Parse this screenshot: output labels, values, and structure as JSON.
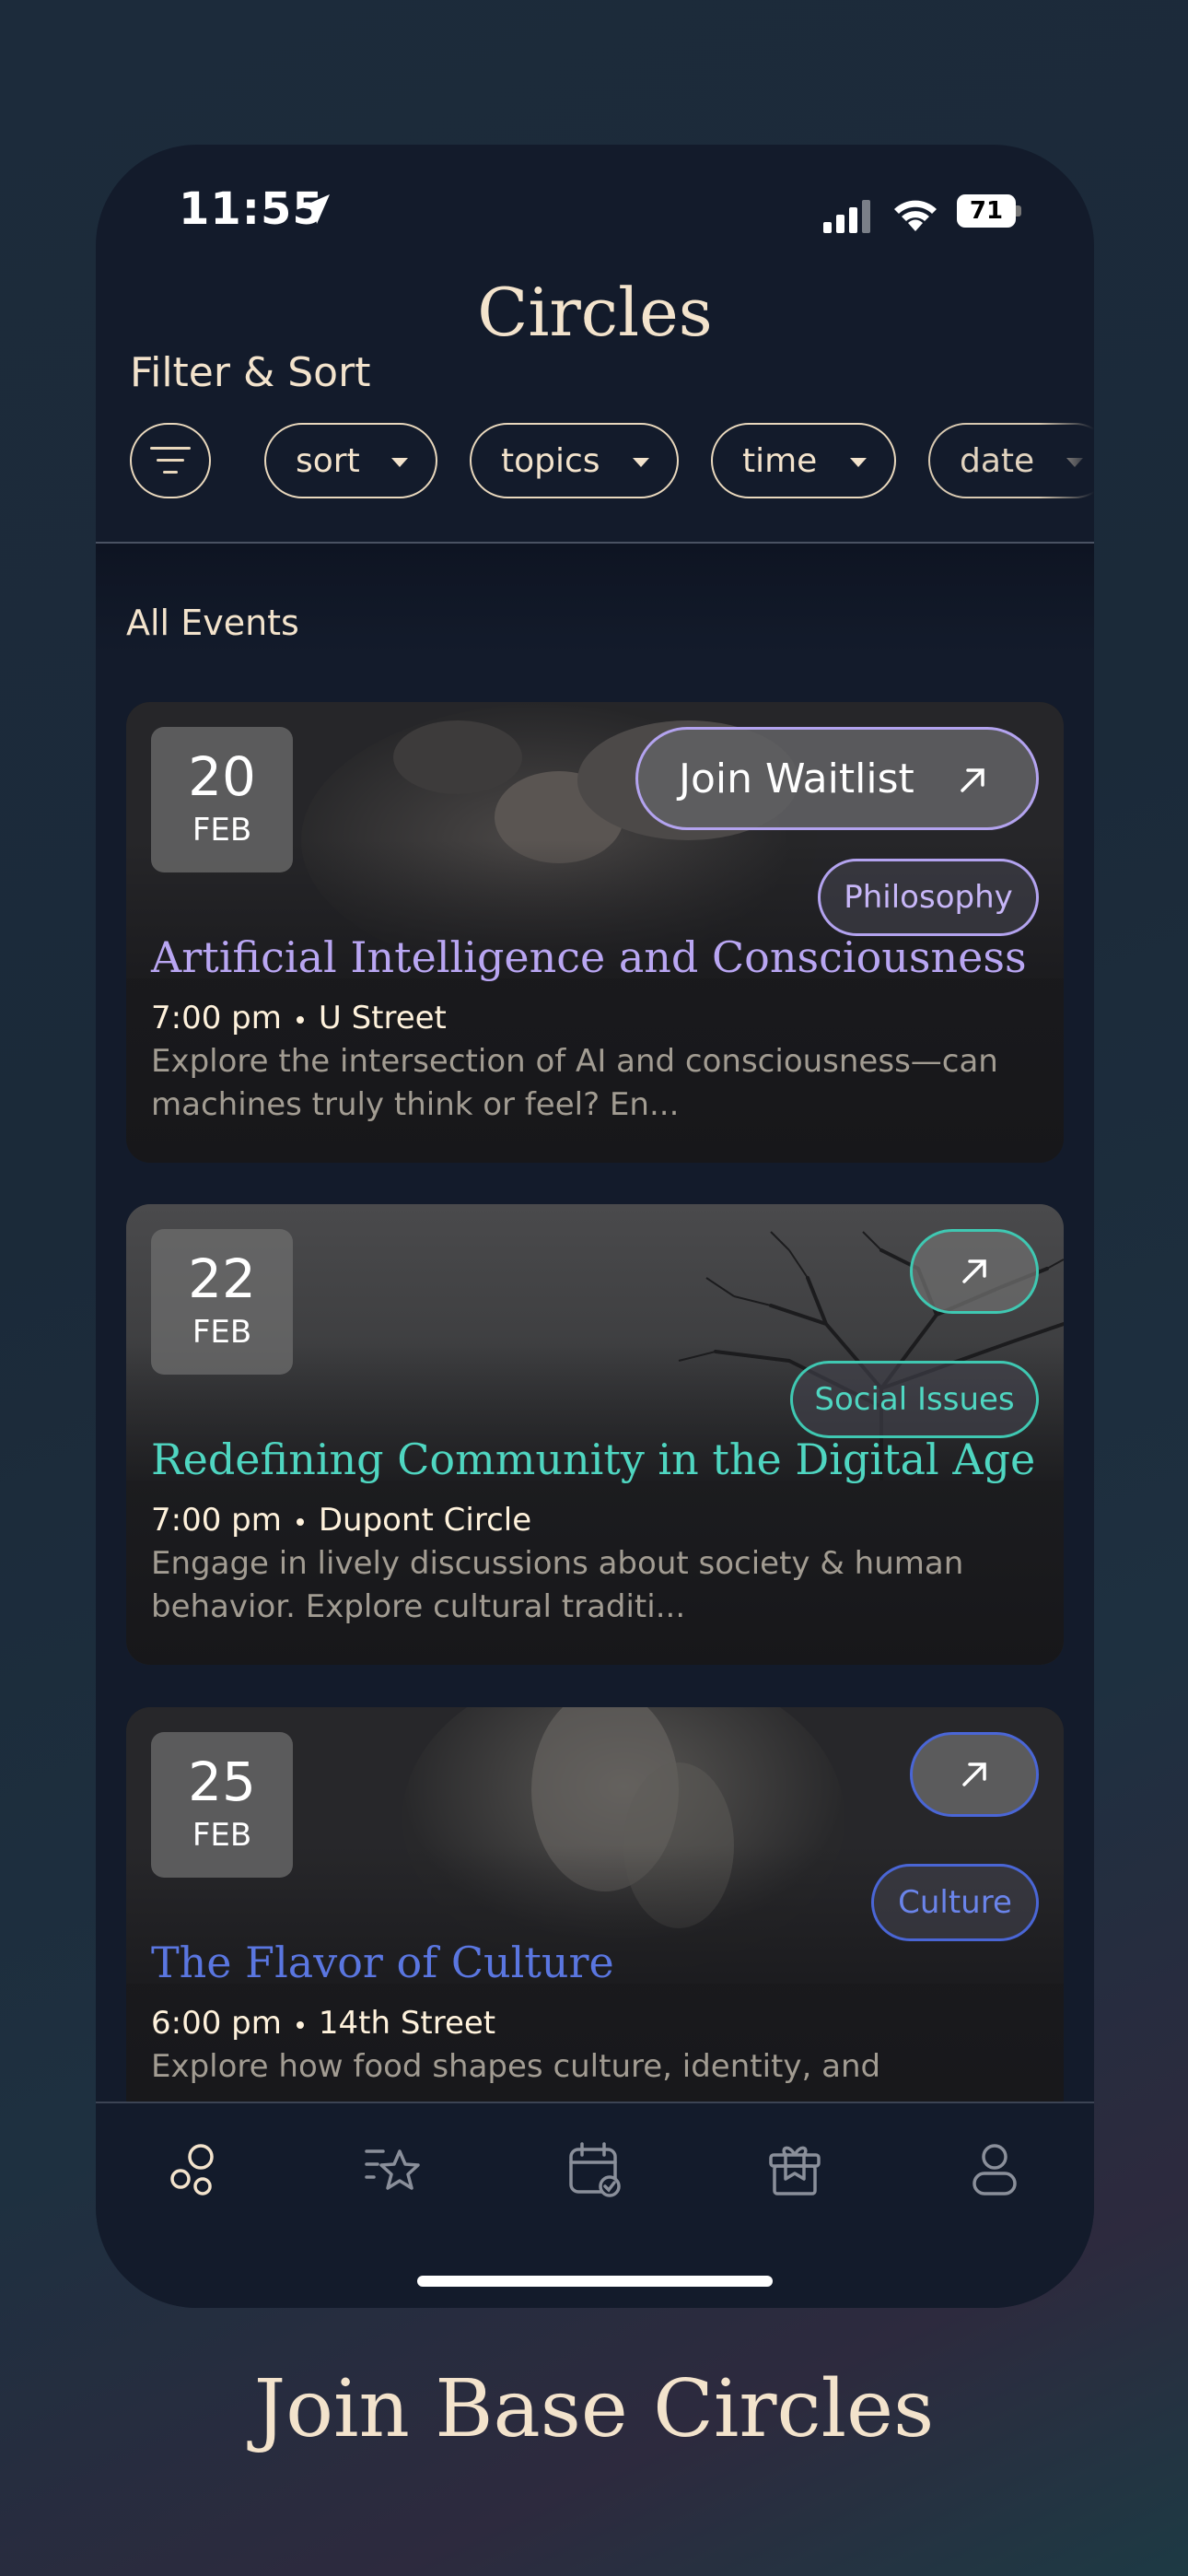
{
  "status_bar": {
    "time": "11:55",
    "battery": "71"
  },
  "header": {
    "title": "Circles",
    "filter_heading": "Filter & Sort"
  },
  "filters": {
    "chips": [
      "sort",
      "topics",
      "time",
      "date"
    ]
  },
  "section_label": "All Events",
  "events": [
    {
      "day": "20",
      "month": "FEB",
      "title": "Artificial Intelligence and Consciousness",
      "time": "7:00 pm",
      "location": "U Street",
      "description": "Explore the intersection of AI and consciousness—can machines truly think or feel? En...",
      "tag": "Philosophy",
      "action_label": "Join Waitlist",
      "accent": "#b3a3ef"
    },
    {
      "day": "22",
      "month": "FEB",
      "title": "Redefining Community in the Digital Age",
      "time": "7:00 pm",
      "location": "Dupont Circle",
      "description": "Engage in lively discussions about society & human behavior. Explore cultural traditi...",
      "tag": "Social Issues",
      "accent": "#3fc8b2"
    },
    {
      "day": "25",
      "month": "FEB",
      "title": "The Flavor of Culture",
      "time": "6:00 pm",
      "location": "14th Street",
      "description": "Explore how food shapes culture, identity, and",
      "tag": "Culture",
      "accent": "#4a66d6"
    }
  ],
  "tabbar": {
    "icons": [
      "circles-icon",
      "favorites-list-icon",
      "calendar-check-icon",
      "gift-icon",
      "profile-icon"
    ]
  },
  "tagline": "Join Base Circles"
}
